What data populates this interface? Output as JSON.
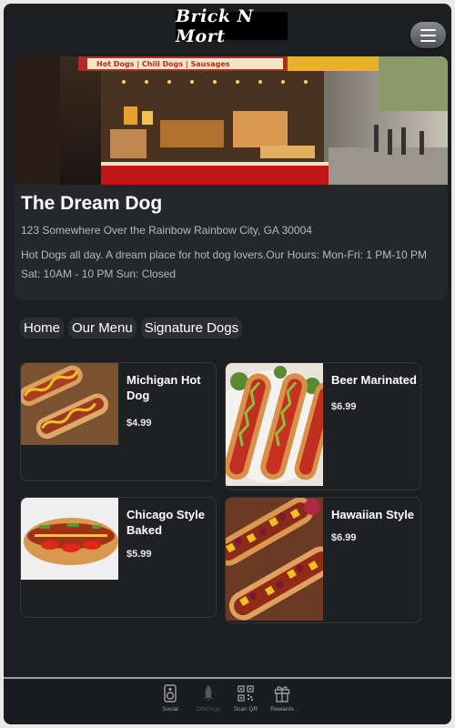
{
  "header": {
    "logo_text": "Brick N Mort",
    "menu_icon": "hamburger-menu-icon"
  },
  "hero": {
    "image_alt": "hot dog cart street",
    "sign_text": "Hot Dogs | Chili Dogs | Sausages",
    "title": "The Dream Dog",
    "address": "123 Somewhere Over the Rainbow Rainbow City, GA 30004",
    "description": "Hot Dogs all day. A dream place for hot dog lovers.Our Hours: Mon-Fri: 1 PM-10 PM Sat: 10AM - 10 PM Sun: Closed"
  },
  "tabs": [
    {
      "label": "Home"
    },
    {
      "label": "Our Menu"
    },
    {
      "label": "Signature Dogs"
    }
  ],
  "menu_items": [
    {
      "name": "Michigan Hot Dog",
      "price": "$4.99"
    },
    {
      "name": "Beer Marinated",
      "price": "$6.99"
    },
    {
      "name": "Chicago Style Baked",
      "price": "$5.99"
    },
    {
      "name": "Hawaiian Style",
      "price": "$6.99"
    }
  ],
  "bottom_nav": [
    {
      "label": "Social",
      "icon": "speaker-icon"
    },
    {
      "label": "Offerings",
      "icon": "rocket-icon"
    },
    {
      "label": "Scan QR",
      "icon": "qr-code-icon"
    },
    {
      "label": "Rewards",
      "icon": "gift-icon"
    }
  ],
  "colors": {
    "background": "#1d1e21",
    "card": "#26272b",
    "text": "#ffffff",
    "muted_text": "#b7b8bc"
  }
}
